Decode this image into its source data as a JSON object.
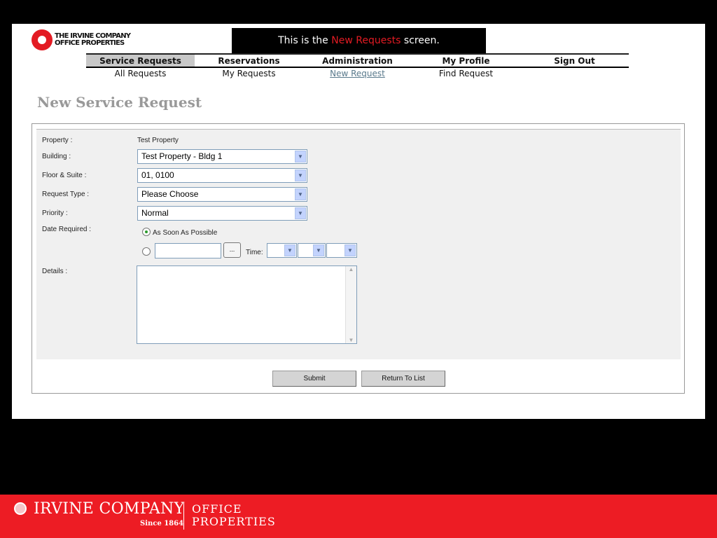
{
  "logo": {
    "line1": "THE IRVINE COMPANY",
    "line2": "OFFICE PROPERTIES"
  },
  "banner": {
    "prefix": "This is the ",
    "highlight": "New Requests",
    "suffix": " screen."
  },
  "nav": {
    "items": [
      "Service Requests",
      "Reservations",
      "Administration",
      "My Profile",
      "Sign Out"
    ]
  },
  "subnav": {
    "items": [
      "All Requests",
      "My Requests",
      "New Request",
      "Find Request"
    ]
  },
  "page_title": "New Service Request",
  "form": {
    "property_label": "Property :",
    "property_value": "Test Property",
    "building_label": "Building :",
    "building_value": "Test Property - Bldg 1",
    "floor_label": "Floor & Suite :",
    "floor_value": "01, 0100",
    "type_label": "Request Type :",
    "type_value": "Please Choose",
    "priority_label": "Priority :",
    "priority_value": "Normal",
    "date_label": "Date Required :",
    "asap_label": "As Soon As Possible",
    "date_value": "",
    "calendar_button": "...",
    "time_label": "Time:",
    "details_label": "Details :",
    "details_value": ""
  },
  "buttons": {
    "submit": "Submit",
    "return": "Return To List"
  },
  "footer": {
    "name": "IRVINE COMPANY",
    "since": "Since 1864",
    "op1": "OFFICE",
    "op2": "PROPERTIES"
  }
}
